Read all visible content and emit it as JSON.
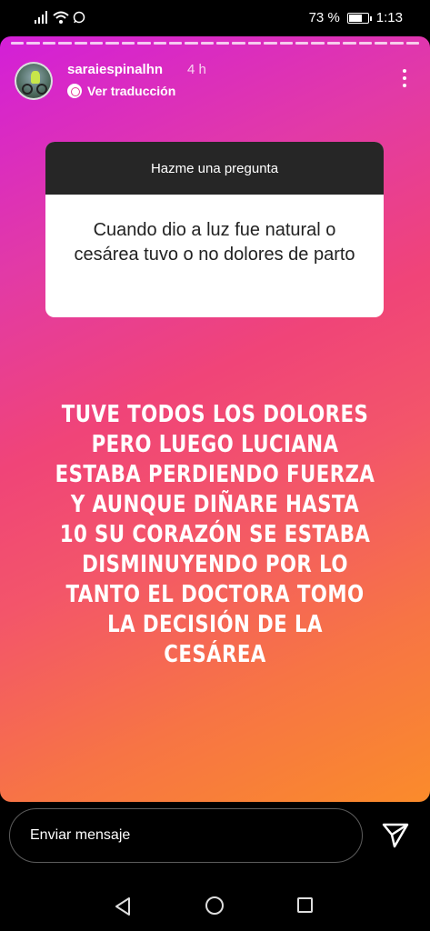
{
  "status_bar": {
    "battery": "73 %",
    "battery_level": 0.73,
    "clock": "1:13"
  },
  "story": {
    "username": "saraiespinalhn",
    "time_ago": "4 h",
    "translate_label": "Ver traducción",
    "question_box": {
      "header": "Hazme una pregunta",
      "question": "Cuando dio a luz fue natural o cesárea tuvo o no dolores de parto"
    },
    "answer_text": "TUVE TODOS LOS DOLORES PERO LUEGO LUCIANA ESTABA PERDIENDO FUERZA Y AUNQUE DIÑARE HASTA 10 SU CORAZÓN SE ESTABA DISMINUYENDO POR LO TANTO EL DOCTORA TOMO LA DECISIÓN DE LA CESÁREA",
    "gradient_colors": [
      "#d31fd8",
      "#f04478",
      "#fa8b2b"
    ]
  },
  "message_bar": {
    "placeholder": "Enviar mensaje"
  },
  "icons": {
    "signal": "signal-icon",
    "wifi": "wifi-icon",
    "whatsapp": "whatsapp-icon",
    "battery": "battery-icon",
    "more": "more-vertical-icon",
    "send": "send-icon",
    "back": "back-icon",
    "home": "home-icon",
    "recent": "recent-apps-icon"
  }
}
